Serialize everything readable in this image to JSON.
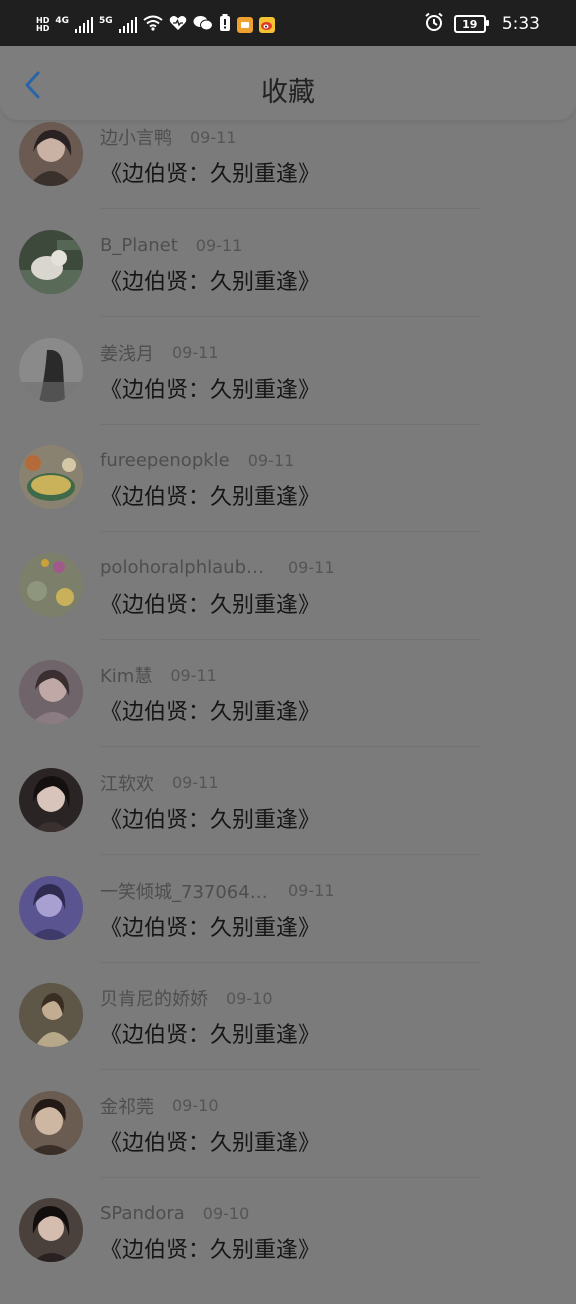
{
  "status_bar": {
    "network_labels": [
      "HD",
      "HD"
    ],
    "signal1": "4G",
    "signal2": "5G",
    "battery_level": "19",
    "time": "5:33",
    "icons": [
      "signal-4g-icon",
      "signal-5g-icon",
      "wifi-icon",
      "health-icon",
      "wechat-icon",
      "alert-icon",
      "app-icon",
      "weibo-icon",
      "alarm-icon",
      "battery-icon"
    ]
  },
  "header": {
    "back_icon": "back-arrow-icon",
    "title": "收藏"
  },
  "items": [
    {
      "name": "边小言鸭",
      "date": "09-11",
      "title": "《边伯贤：久别重逢》",
      "avatar_color": "#5a4a44"
    },
    {
      "name": "B_Planet",
      "date": "09-11",
      "title": "《边伯贤：久别重逢》",
      "avatar_color": "#3f4a3a"
    },
    {
      "name": "姜浅月",
      "date": "09-11",
      "title": "《边伯贤：久别重逢》",
      "avatar_color": "#6d6d6d"
    },
    {
      "name": "fureepenopkle",
      "date": "09-11",
      "title": "《边伯贤：久别重逢》",
      "avatar_color": "#6b6a4e"
    },
    {
      "name": "polohoralphlaubre...",
      "date": "09-11",
      "title": "《边伯贤：久别重逢》",
      "avatar_color": "#77785a"
    },
    {
      "name": "Kim慧",
      "date": "09-11",
      "title": "《边伯贤：久别重逢》",
      "avatar_color": "#5b4f55"
    },
    {
      "name": "江软欢",
      "date": "09-11",
      "title": "《边伯贤：久别重逢》",
      "avatar_color": "#3a3434"
    },
    {
      "name": "一笑倾城_7370640...",
      "date": "09-11",
      "title": "《边伯贤：久别重逢》",
      "avatar_color": "#4e4a7a"
    },
    {
      "name": "贝肯尼的娇娇",
      "date": "09-10",
      "title": "《边伯贤：久别重逢》",
      "avatar_color": "#5a5244"
    },
    {
      "name": "金祁莞",
      "date": "09-10",
      "title": "《边伯贤：久别重逢》",
      "avatar_color": "#50443c"
    },
    {
      "name": "SPandora",
      "date": "09-10",
      "title": "《边伯贤：久别重逢》",
      "avatar_color": "#3c3636"
    }
  ]
}
